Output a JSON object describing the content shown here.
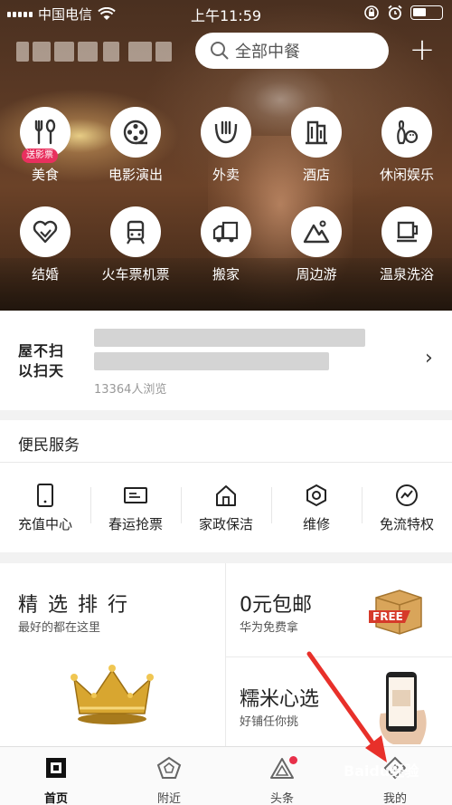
{
  "status_bar": {
    "carrier": "中国电信",
    "time": "上午11:59"
  },
  "header": {
    "search_placeholder": "全部中餐",
    "add_symbol": "+"
  },
  "categories": [
    {
      "label": "美食",
      "icon": "fork-spoon-icon",
      "badge": "送影票"
    },
    {
      "label": "电影演出",
      "icon": "film-reel-icon"
    },
    {
      "label": "外卖",
      "icon": "takeout-icon"
    },
    {
      "label": "酒店",
      "icon": "hotel-icon"
    },
    {
      "label": "休闲娱乐",
      "icon": "bowling-icon"
    },
    {
      "label": "结婚",
      "icon": "heart-icon"
    },
    {
      "label": "火车票机票",
      "icon": "train-icon"
    },
    {
      "label": "搬家",
      "icon": "truck-icon"
    },
    {
      "label": "周边游",
      "icon": "mountain-icon"
    },
    {
      "label": "温泉洗浴",
      "icon": "bath-icon"
    }
  ],
  "banner": {
    "logo_line1": "屋不扫",
    "logo_line2": "以扫天",
    "subtitle": "13364人浏览"
  },
  "services": {
    "title": "便民服务",
    "items": [
      {
        "label": "充值中心",
        "icon": "phone-icon"
      },
      {
        "label": "春运抢票",
        "icon": "ticket-icon"
      },
      {
        "label": "家政保洁",
        "icon": "house-icon"
      },
      {
        "label": "维修",
        "icon": "hex-nut-icon"
      },
      {
        "label": "免流特权",
        "icon": "trend-icon"
      }
    ]
  },
  "promos": [
    {
      "title": "精 选 排 行",
      "subtitle": "最好的都在这里",
      "image": "crown"
    },
    {
      "title": "0元包邮",
      "subtitle": "华为免费拿",
      "image": "free-box",
      "image_text": "FREE"
    },
    {
      "title": "糯米心选",
      "subtitle": "好铺任你挑",
      "image": "phone-in-hand"
    }
  ],
  "tabbar": [
    {
      "label": "首页",
      "icon": "home-square-icon",
      "active": true
    },
    {
      "label": "附近",
      "icon": "pentagon-icon"
    },
    {
      "label": "头条",
      "icon": "news-triangle-icon",
      "dot": true
    },
    {
      "label": "我的",
      "icon": "profile-icon"
    }
  ],
  "watermark": "Baidu经验",
  "colors": {
    "accent_red": "#e8304a",
    "badge_pink": "#e8305e",
    "crown_gold": "#d8a630"
  }
}
